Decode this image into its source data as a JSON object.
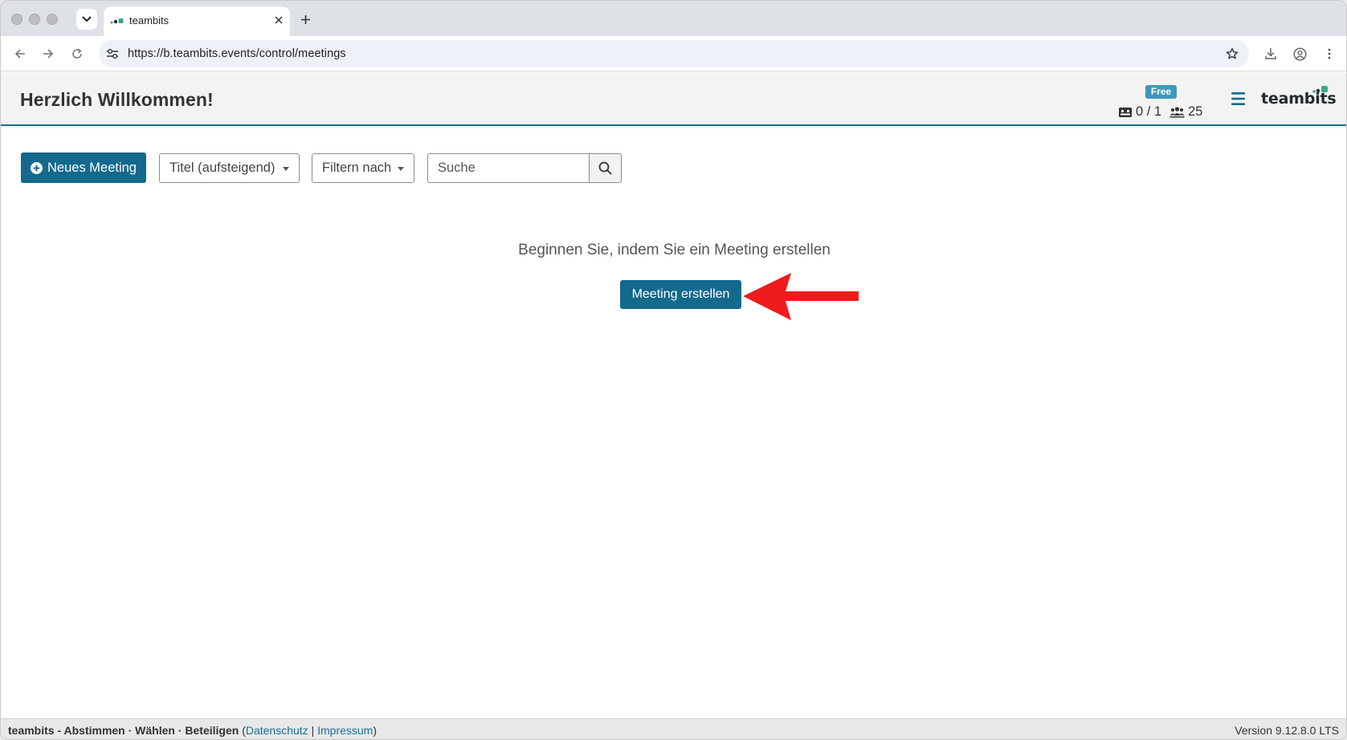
{
  "browser": {
    "tab_title": "teambits",
    "url": "https://b.teambits.events/control/meetings"
  },
  "header": {
    "title": "Herzlich Willkommen!",
    "plan_badge": "Free",
    "meetings_quota": "0 / 1",
    "participants_quota": "25",
    "brand": "teambits",
    "brand_color": "#1e2a2e",
    "accent_color": "#136a8d",
    "brand_dot_color": "#3aa88f"
  },
  "controls": {
    "new_meeting_label": "Neues Meeting",
    "sort_label": "Titel (aufsteigend)",
    "filter_label": "Filtern nach",
    "search_placeholder": "Suche"
  },
  "empty_state": {
    "message": "Beginnen Sie, indem Sie ein Meeting erstellen",
    "create_button_label": "Meeting erstellen",
    "annotation_arrow_color": "#ee1c1c"
  },
  "footer": {
    "tagline": "teambits - Abstimmen · Wählen · Beteiligen",
    "paren_open": "(",
    "privacy_link": "Datenschutz",
    "separator": "|",
    "imprint_link": "Impressum",
    "paren_close": ")",
    "version": "Version 9.12.8.0 LTS"
  }
}
